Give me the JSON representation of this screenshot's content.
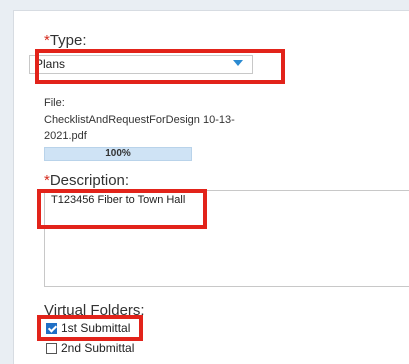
{
  "form": {
    "type_required_mark": "*",
    "type_label": "Type:",
    "type_value": "Plans",
    "file_label": "File:",
    "file_name": "ChecklistAndRequestForDesign 10-13-2021.pdf",
    "upload_progress_text": "100%",
    "upload_progress": 1.0,
    "description_required_mark": "*",
    "description_label": "Description:",
    "description_value": "T123456 Fiber to Town Hall",
    "virtual_folders_label": "Virtual Folders:",
    "folders": [
      {
        "label": "1st Submittal",
        "checked": true
      },
      {
        "label": "2nd Submittal",
        "checked": false
      }
    ]
  },
  "colors": {
    "highlight": "#e2231a",
    "required": "#d52b1e",
    "dropdown_arrow": "#2b8ad1",
    "checkbox_checked": "#1f6fc5"
  }
}
